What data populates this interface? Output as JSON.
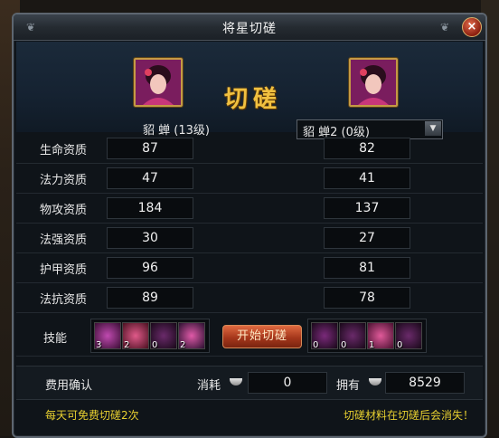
{
  "dialog": {
    "title": "将星切磋",
    "close_label": "×"
  },
  "header": {
    "vs_title": "切磋",
    "left_name": "貂 蝉 (13级)",
    "right_select_value": "貂 蝉2 (0级)"
  },
  "stats": [
    {
      "label": "生命资质",
      "left": "87",
      "right": "82"
    },
    {
      "label": "法力资质",
      "left": "47",
      "right": "41"
    },
    {
      "label": "物攻资质",
      "left": "184",
      "right": "137"
    },
    {
      "label": "法强资质",
      "left": "30",
      "right": "27"
    },
    {
      "label": "护甲资质",
      "left": "96",
      "right": "81"
    },
    {
      "label": "法抗资质",
      "left": "89",
      "right": "78"
    }
  ],
  "skills": {
    "label": "技能",
    "left": [
      {
        "icon": "purple-skill-icon",
        "count": "3"
      },
      {
        "icon": "pink-skill-icon",
        "count": "2"
      },
      {
        "icon": "dark-skill-icon",
        "count": "0"
      },
      {
        "icon": "flower-skill-icon",
        "count": "2"
      }
    ],
    "start_button": "开始切磋",
    "right": [
      {
        "icon": "dark-skill-icon",
        "count": "0"
      },
      {
        "icon": "dark-skill-icon",
        "count": "0"
      },
      {
        "icon": "pink-skill-icon",
        "count": "1"
      },
      {
        "icon": "dark-skill-icon",
        "count": "0"
      }
    ]
  },
  "cost": {
    "label": "费用确认",
    "consume_label": "消耗",
    "consume_value": "0",
    "own_label": "拥有",
    "own_value": "8529"
  },
  "footer": {
    "left_note": "每天可免费切磋2次",
    "right_note": "切磋材料在切磋后会消失！"
  },
  "colors": {
    "accent_gold": "#f0c040",
    "note_yellow": "#e8d030",
    "button_orange": "#c04a22"
  }
}
